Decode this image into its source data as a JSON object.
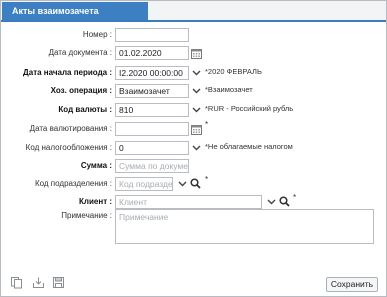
{
  "tab": {
    "title": "Акты взаимозачета"
  },
  "fields": {
    "number": {
      "label": "Номер :",
      "value": ""
    },
    "doc_date": {
      "label": "Дата документа :",
      "value": "01.02.2020"
    },
    "period_start": {
      "label": "Дата начала периода :",
      "value": "I2.2020 00:00:00",
      "note": "*2020 ФЕВРАЛЬ"
    },
    "operation": {
      "label": "Хоз. операция :",
      "value": "Взаимозачет",
      "note": "*Взаимозачет"
    },
    "currency": {
      "label": "Код валюты :",
      "value": "810",
      "note": "*RUR - Российский рубль"
    },
    "currency_date": {
      "label": "Дата валютирования :",
      "value": "",
      "note": "*"
    },
    "tax_code": {
      "label": "Код налогообложения :",
      "value": "0",
      "note": "*Не облагаемые налогом"
    },
    "sum": {
      "label": "Сумма :",
      "placeholder": "Сумма по документу"
    },
    "department": {
      "label": "Код подразделения :",
      "placeholder": "Код подразде",
      "note": "*"
    },
    "client": {
      "label": "Клиент :",
      "placeholder": "Клиент",
      "note": "*"
    },
    "comment": {
      "label": "Примечание :",
      "placeholder": "Примечание"
    }
  },
  "buttons": {
    "save": "Сохранить"
  },
  "icons": [
    "calendar-icon",
    "chevron-down-icon",
    "search-icon",
    "copy-icon",
    "download-icon",
    "save-icon"
  ]
}
